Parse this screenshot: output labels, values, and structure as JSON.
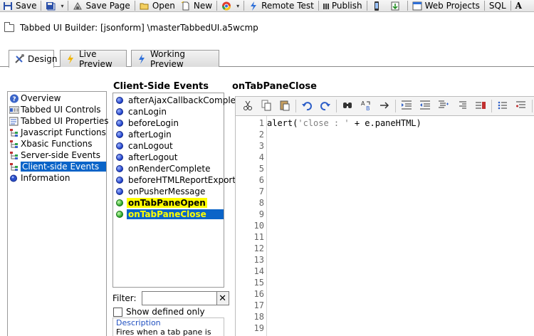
{
  "toolbar": {
    "buttons": [
      {
        "label": "Save",
        "icon": "floppy-disk-icon"
      },
      {
        "label": "",
        "icon": "save-all-icon"
      },
      {
        "label": "Save Page",
        "icon": "save-page-icon"
      },
      {
        "label": "Open",
        "icon": "folder-open-icon"
      },
      {
        "label": "New",
        "icon": "new-document-icon"
      },
      {
        "label": "",
        "icon": "browser-icon"
      },
      {
        "label": "Remote Test",
        "icon": "lightning-icon"
      },
      {
        "label": "Publish",
        "icon": "publish-icon"
      },
      {
        "label": "",
        "icon": "phone-icon"
      },
      {
        "label": "",
        "icon": "export-icon"
      },
      {
        "label": "Web Projects",
        "icon": "web-projects-icon"
      },
      {
        "label": "SQL",
        "icon": ""
      },
      {
        "label": "",
        "icon": "font-icon"
      }
    ],
    "font_glyph": "A"
  },
  "path": "Tabbed UI Builder: [jsonform] \\masterTabbedUI.a5wcmp",
  "tabs": [
    {
      "label": "Design",
      "icon": "design-tools-icon",
      "active": true
    },
    {
      "label": "Live Preview",
      "icon": "lightning-icon",
      "active": false
    },
    {
      "label": "Working Preview",
      "icon": "lightning-icon",
      "active": false
    }
  ],
  "nav": {
    "items": [
      {
        "label": "Overview",
        "icon": "help-icon"
      },
      {
        "label": "Tabbed UI Controls",
        "icon": "controls-icon"
      },
      {
        "label": "Tabbed UI Properties",
        "icon": "properties-icon"
      },
      {
        "label": "Javascript Functions",
        "icon": "tree-icon"
      },
      {
        "label": "Xbasic Functions",
        "icon": "tree-icon"
      },
      {
        "label": "Server-side Events",
        "icon": "tree-icon"
      },
      {
        "label": "Client-side Events",
        "icon": "tree-icon",
        "selected": true
      },
      {
        "label": "Information",
        "icon": "info-dot-icon"
      }
    ]
  },
  "events": {
    "title": "Client-Side Events",
    "items": [
      {
        "label": "afterAjaxCallbackComplete",
        "state": "undefined"
      },
      {
        "label": "canLogin",
        "state": "undefined"
      },
      {
        "label": "beforeLogin",
        "state": "undefined"
      },
      {
        "label": "afterLogin",
        "state": "undefined"
      },
      {
        "label": "canLogout",
        "state": "undefined"
      },
      {
        "label": "afterLogout",
        "state": "undefined"
      },
      {
        "label": "onRenderComplete",
        "state": "undefined"
      },
      {
        "label": "beforeHTMLReportExport",
        "state": "undefined"
      },
      {
        "label": "onPusherMessage",
        "state": "undefined"
      },
      {
        "label": "onTabPaneOpen",
        "state": "defined",
        "highlight": true
      },
      {
        "label": "onTabPaneClose",
        "state": "defined",
        "selected": true
      }
    ],
    "filter_label": "Filter:",
    "filter_value": "",
    "clear_glyph": "✕",
    "show_defined_label": "Show defined only",
    "show_defined_checked": false,
    "description_title": "Description",
    "description_text": "Fires when a tab pane is"
  },
  "editor": {
    "title": "onTabPaneClose",
    "toolbar_icons": [
      "cut-icon",
      "copy-icon",
      "paste-icon",
      "undo-icon",
      "redo-icon",
      "find-icon",
      "replace-icon",
      "goto-icon",
      "indent-icon",
      "outdent-icon",
      "format-icon",
      "align-right-icon",
      "wrap-icon",
      "list-icon",
      "list-indent-icon",
      "library-icon"
    ],
    "line_numbers": [
      "1",
      "2",
      "3",
      "4",
      "5",
      "6",
      "7",
      "8",
      "9",
      "10",
      "11",
      "12",
      "13",
      "14",
      "15",
      "16",
      "17",
      "18",
      "19"
    ],
    "code": {
      "func": "alert(",
      "str": "'close : '",
      "rest": " + e.paneHTML)"
    }
  },
  "colors": {
    "selection_blue": "#0a64c8",
    "highlight_yellow": "#ffff00",
    "defined_green": "#20a020",
    "undefined_blue": "#1a3cc8"
  }
}
